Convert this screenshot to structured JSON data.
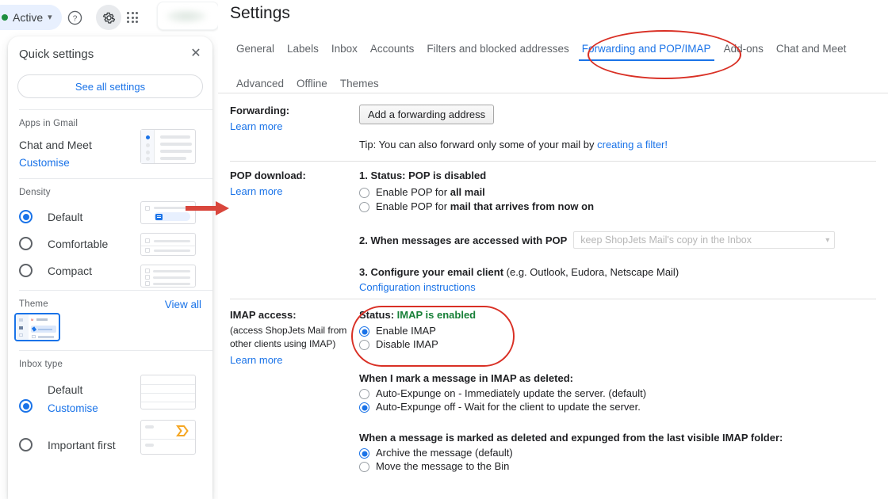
{
  "topbar": {
    "status_chip": "Active",
    "help_icon": "help-icon",
    "settings_icon": "gear-icon",
    "apps_icon": "apps-grid-icon",
    "accent": "#1a73e8"
  },
  "quick_settings": {
    "title": "Quick settings",
    "close_label": "✕",
    "see_all_label": "See all settings",
    "apps_section": {
      "label": "Apps in Gmail",
      "item_label": "Chat and Meet",
      "customise_label": "Customise"
    },
    "density_section": {
      "label": "Density",
      "options": [
        {
          "label": "Default",
          "selected": true
        },
        {
          "label": "Comfortable",
          "selected": false
        },
        {
          "label": "Compact",
          "selected": false
        }
      ]
    },
    "theme_section": {
      "label": "Theme",
      "view_all_label": "View all",
      "thumb_brand": "Gmail"
    },
    "inbox_type_section": {
      "label": "Inbox type",
      "options": [
        {
          "label": "Default",
          "selected": true,
          "sub_label": "Customise"
        },
        {
          "label": "Important first",
          "selected": false,
          "sub_label": ""
        }
      ]
    }
  },
  "settings": {
    "page_title": "Settings",
    "tabs_row1": [
      {
        "label": "General",
        "active": false
      },
      {
        "label": "Labels",
        "active": false
      },
      {
        "label": "Inbox",
        "active": false
      },
      {
        "label": "Accounts",
        "active": false
      },
      {
        "label": "Filters and blocked addresses",
        "active": false
      },
      {
        "label": "Forwarding and POP/IMAP",
        "active": true
      },
      {
        "label": "Add-ons",
        "active": false
      },
      {
        "label": "Chat and Meet",
        "active": false
      }
    ],
    "tabs_row2": [
      {
        "label": "Advanced",
        "active": false
      },
      {
        "label": "Offline",
        "active": false
      },
      {
        "label": "Themes",
        "active": false
      }
    ],
    "forwarding": {
      "label": "Forwarding:",
      "learn_more": "Learn more",
      "add_button": "Add a forwarding address",
      "tip_prefix": "Tip: You can also forward only some of your mail by ",
      "tip_link": "creating a filter!"
    },
    "pop": {
      "label": "POP download:",
      "learn_more": "Learn more",
      "status": "1. Status: POP is disabled",
      "option_all_prefix": "Enable POP for ",
      "option_all_bold": "all mail",
      "option_now_prefix": "Enable POP for ",
      "option_now_bold": "mail that arrives from now on",
      "step2_label": "2. When messages are accessed with POP",
      "step2_select_value": "keep ShopJets Mail's copy in the Inbox",
      "step3_bold": "3. Configure your email client",
      "step3_rest": " (e.g. Outlook, Eudora, Netscape Mail)",
      "config_link": "Configuration instructions"
    },
    "imap": {
      "label": "IMAP access:",
      "sub_line1": "(access ShopJets Mail from",
      "sub_line2": "other clients using IMAP)",
      "learn_more": "Learn more",
      "status_prefix": "Status: ",
      "status_value": "IMAP is enabled",
      "enable_label": "Enable IMAP",
      "disable_label": "Disable IMAP",
      "enable_selected": true,
      "deleted_heading": "When I mark a message in IMAP as deleted:",
      "deleted_options": [
        {
          "label": "Auto-Expunge on - Immediately update the server. (default)",
          "selected": false
        },
        {
          "label": "Auto-Expunge off - Wait for the client to update the server.",
          "selected": true
        }
      ],
      "expunged_heading": "When a message is marked as deleted and expunged from the last visible IMAP folder:",
      "expunged_options": [
        {
          "label": "Archive the message (default)",
          "selected": true
        },
        {
          "label": "Move the message to the Bin",
          "selected": false
        }
      ]
    }
  },
  "annotations": {
    "highlight_color": "#d93025",
    "oval_tab_target": "Forwarding and POP/IMAP",
    "oval_imap_target": "IMAP status radio group",
    "arrow_target": "Density Default"
  }
}
